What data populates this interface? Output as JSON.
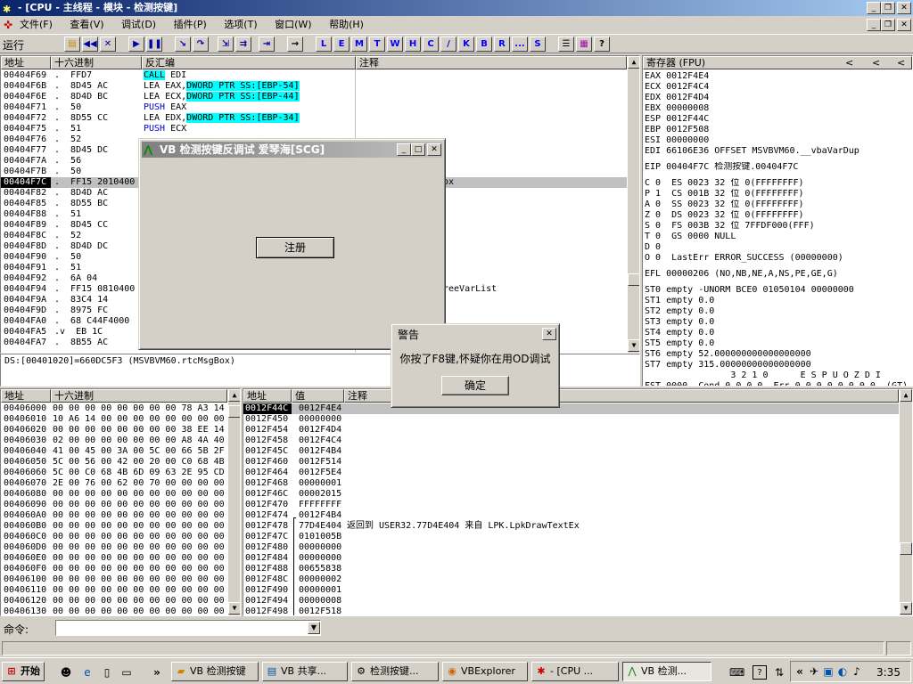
{
  "title": "- [CPU - 主线程 - 模块 - 检测按键]",
  "menu": [
    "文件(F)",
    "查看(V)",
    "调试(D)",
    "插件(P)",
    "选项(T)",
    "窗口(W)",
    "帮助(H)"
  ],
  "toolbar": {
    "status": "运行",
    "letters": [
      "L",
      "E",
      "M",
      "T",
      "W",
      "H",
      "C",
      "/",
      "K",
      "B",
      "R",
      "...",
      "S"
    ]
  },
  "disasm": {
    "headers": {
      "addr": "地址",
      "hex": "十六进制",
      "dis": "反汇编",
      "cmt": "注释"
    },
    "rows": [
      {
        "a": "00404F69",
        "m": ".",
        "h": "FFD7",
        "d": "CALL EDI",
        "c": ""
      },
      {
        "a": "00404F6B",
        "m": ".",
        "h": "8D45 AC",
        "d": "LEA EAX,DWORD PTR SS:[EBP-54]",
        "c": ""
      },
      {
        "a": "00404F6E",
        "m": ".",
        "h": "8D4D BC",
        "d": "LEA ECX,DWORD PTR SS:[EBP-44]",
        "c": ""
      },
      {
        "a": "00404F71",
        "m": ".",
        "h": "50",
        "d": "PUSH EAX",
        "c": ""
      },
      {
        "a": "00404F72",
        "m": ".",
        "h": "8D55 CC",
        "d": "LEA EDX,DWORD PTR SS:[EBP-34]",
        "c": ""
      },
      {
        "a": "00404F75",
        "m": ".",
        "h": "51",
        "d": "PUSH ECX",
        "c": ""
      },
      {
        "a": "00404F76",
        "m": ".",
        "h": "52",
        "d": "",
        "c": ""
      },
      {
        "a": "00404F77",
        "m": ".",
        "h": "8D45 DC",
        "d": "",
        "c": ""
      },
      {
        "a": "00404F7A",
        "m": ".",
        "h": "56",
        "d": "",
        "c": ""
      },
      {
        "a": "00404F7B",
        "m": ".",
        "h": "50",
        "d": "",
        "c": ""
      },
      {
        "a": "00404F7C",
        "m": ".",
        "h": "FF15 2010400",
        "d": "",
        "c": "ox"
      },
      {
        "a": "00404F82",
        "m": ".",
        "h": "8D4D AC",
        "d": "",
        "c": ""
      },
      {
        "a": "00404F85",
        "m": ".",
        "h": "8D55 BC",
        "d": "",
        "c": ""
      },
      {
        "a": "00404F88",
        "m": ".",
        "h": "51",
        "d": "",
        "c": ""
      },
      {
        "a": "00404F89",
        "m": ".",
        "h": "8D45 CC",
        "d": "",
        "c": ""
      },
      {
        "a": "00404F8C",
        "m": ".",
        "h": "52",
        "d": "",
        "c": ""
      },
      {
        "a": "00404F8D",
        "m": ".",
        "h": "8D4D DC",
        "d": "",
        "c": ""
      },
      {
        "a": "00404F90",
        "m": ".",
        "h": "50",
        "d": "",
        "c": ""
      },
      {
        "a": "00404F91",
        "m": ".",
        "h": "51",
        "d": "",
        "c": ""
      },
      {
        "a": "00404F92",
        "m": ".",
        "h": "6A 04",
        "d": "",
        "c": ""
      },
      {
        "a": "00404F94",
        "m": ".",
        "h": "FF15 0810400",
        "d": "",
        "c": "reeVarList"
      },
      {
        "a": "00404F9A",
        "m": ".",
        "h": "83C4 14",
        "d": "",
        "c": ""
      },
      {
        "a": "00404F9D",
        "m": ".",
        "h": "8975 FC",
        "d": "",
        "c": ""
      },
      {
        "a": "00404FA0",
        "m": ".",
        "h": "68 C44F4000",
        "d": "",
        "c": ""
      },
      {
        "a": "00404FA5",
        "m": ".v",
        "h": "EB 1C",
        "d": "",
        "c": ""
      },
      {
        "a": "00404FA7",
        "m": ".",
        "h": "8B55 AC",
        "d": "",
        "c": ""
      }
    ],
    "info": "DS:[00401020]=660DC5F3 (MSVBVM60.rtcMsgBox)"
  },
  "registers": {
    "header": "寄存器 (FPU)",
    "lines": [
      "EAX 0012F4E4",
      "ECX 0012F4C4",
      "EDX 0012F4D4",
      "EBX 00000008",
      "ESP 0012F44C",
      "EBP 0012F508",
      "ESI 00000000",
      "EDI 66106E36 OFFSET MSVBVM60.__vbaVarDup",
      "",
      "EIP 00404F7C 检测按键.00404F7C",
      "",
      "C 0  ES 0023 32 位 0(FFFFFFFF)",
      "P 1  CS 001B 32 位 0(FFFFFFFF)",
      "A 0  SS 0023 32 位 0(FFFFFFFF)",
      "Z 0  DS 0023 32 位 0(FFFFFFFF)",
      "S 0  FS 003B 32 位 7FFDF000(FFF)",
      "T 0  GS 0000 NULL",
      "D 0",
      "O 0  LastErr ERROR_SUCCESS (00000000)",
      "",
      "EFL 00000206 (NO,NB,NE,A,NS,PE,GE,G)",
      "",
      "ST0 empty -UNORM BCE0 01050104 00000000",
      "ST1 empty 0.0",
      "ST2 empty 0.0",
      "ST3 empty 0.0",
      "ST4 empty 0.0",
      "ST5 empty 0.0",
      "ST6 empty 52.000000000000000000",
      "ST7 empty 315.00000000000000000",
      "                3 2 1 0      E S P U O Z D I",
      "FST 0000  Cond 0 0 0 0  Err 0 0 0 0 0 0 0 0  (GT)"
    ]
  },
  "dump": {
    "headers": {
      "addr": "地址",
      "hex": "十六进制"
    },
    "rows": [
      {
        "a": "00406000",
        "h": "00 00 00 00 00 00 00 00 78 A3 14"
      },
      {
        "a": "00406010",
        "h": "10 A6 14 00 00 00 00 00 00 00 00"
      },
      {
        "a": "00406020",
        "h": "00 00 00 00 00 00 00 00 38 EE 14"
      },
      {
        "a": "00406030",
        "h": "02 00 00 00 00 00 00 00 A8 4A 40"
      },
      {
        "a": "00406040",
        "h": "41 00 45 00 3A 00 5C 00 66 5B 2F"
      },
      {
        "a": "00406050",
        "h": "5C 00 56 00 42 00 20 00 C0 68 4B"
      },
      {
        "a": "00406060",
        "h": "5C 00 C0 68 4B 6D 09 63 2E 95 CD"
      },
      {
        "a": "00406070",
        "h": "2E 00 76 00 62 00 70 00 00 00 00"
      },
      {
        "a": "00406080",
        "h": "00 00 00 00 00 00 00 00 00 00 00"
      },
      {
        "a": "00406090",
        "h": "00 00 00 00 00 00 00 00 00 00 00"
      },
      {
        "a": "004060A0",
        "h": "00 00 00 00 00 00 00 00 00 00 00"
      },
      {
        "a": "004060B0",
        "h": "00 00 00 00 00 00 00 00 00 00 00"
      },
      {
        "a": "004060C0",
        "h": "00 00 00 00 00 00 00 00 00 00 00"
      },
      {
        "a": "004060D0",
        "h": "00 00 00 00 00 00 00 00 00 00 00"
      },
      {
        "a": "004060E0",
        "h": "00 00 00 00 00 00 00 00 00 00 00"
      },
      {
        "a": "004060F0",
        "h": "00 00 00 00 00 00 00 00 00 00 00"
      },
      {
        "a": "00406100",
        "h": "00 00 00 00 00 00 00 00 00 00 00"
      },
      {
        "a": "00406110",
        "h": "00 00 00 00 00 00 00 00 00 00 00"
      },
      {
        "a": "00406120",
        "h": "00 00 00 00 00 00 00 00 00 00 00"
      },
      {
        "a": "00406130",
        "h": "00 00 00 00 00 00 00 00 00 00 00"
      }
    ]
  },
  "stack": {
    "headers": {
      "addr": "地址",
      "val": "值",
      "cmt": "注释"
    },
    "rows": [
      {
        "a": "0012F44C",
        "v": "0012F4E4",
        "c": ""
      },
      {
        "a": "0012F450",
        "v": "00000000",
        "c": ""
      },
      {
        "a": "0012F454",
        "v": "0012F4D4",
        "c": ""
      },
      {
        "a": "0012F458",
        "v": "0012F4C4",
        "c": ""
      },
      {
        "a": "0012F45C",
        "v": "0012F4B4",
        "c": ""
      },
      {
        "a": "0012F460",
        "v": "0012F514",
        "c": ""
      },
      {
        "a": "0012F464",
        "v": "0012F5E4",
        "c": ""
      },
      {
        "a": "0012F468",
        "v": "00000001",
        "c": ""
      },
      {
        "a": "0012F46C",
        "v": "00002015",
        "c": ""
      },
      {
        "a": "0012F470",
        "v": "FFFFFFFF",
        "c": ""
      },
      {
        "a": "0012F474",
        "v": "0012F4B4",
        "c": ""
      },
      {
        "a": "0012F478",
        "v": "77D4E404",
        "c": "返回到 USER32.77D4E404 来自 LPK.LpkDrawTextEx"
      },
      {
        "a": "0012F47C",
        "v": "0101005B",
        "c": ""
      },
      {
        "a": "0012F480",
        "v": "00000000",
        "c": ""
      },
      {
        "a": "0012F484",
        "v": "00000000",
        "c": ""
      },
      {
        "a": "0012F488",
        "v": "00655838",
        "c": ""
      },
      {
        "a": "0012F48C",
        "v": "00000002",
        "c": ""
      },
      {
        "a": "0012F490",
        "v": "00000001",
        "c": ""
      },
      {
        "a": "0012F494",
        "v": "00000008",
        "c": ""
      },
      {
        "a": "0012F498",
        "v": "0012F518",
        "c": ""
      }
    ]
  },
  "vbdialog": {
    "title": "VB 检测按键反调试 爱琴海[SCG]",
    "button": "注册"
  },
  "alert": {
    "title": "警告",
    "message": "你按了F8键,怀疑你在用OD调试",
    "ok": "确定"
  },
  "command": {
    "label": "命令:",
    "value": ""
  },
  "taskbar": {
    "start": "开始",
    "tasks": [
      "VB 检测按键",
      "VB 共享...",
      "检测按键...",
      "VBExplorer",
      "- [CPU ...",
      "VB 检测..."
    ],
    "time": "3:35"
  }
}
